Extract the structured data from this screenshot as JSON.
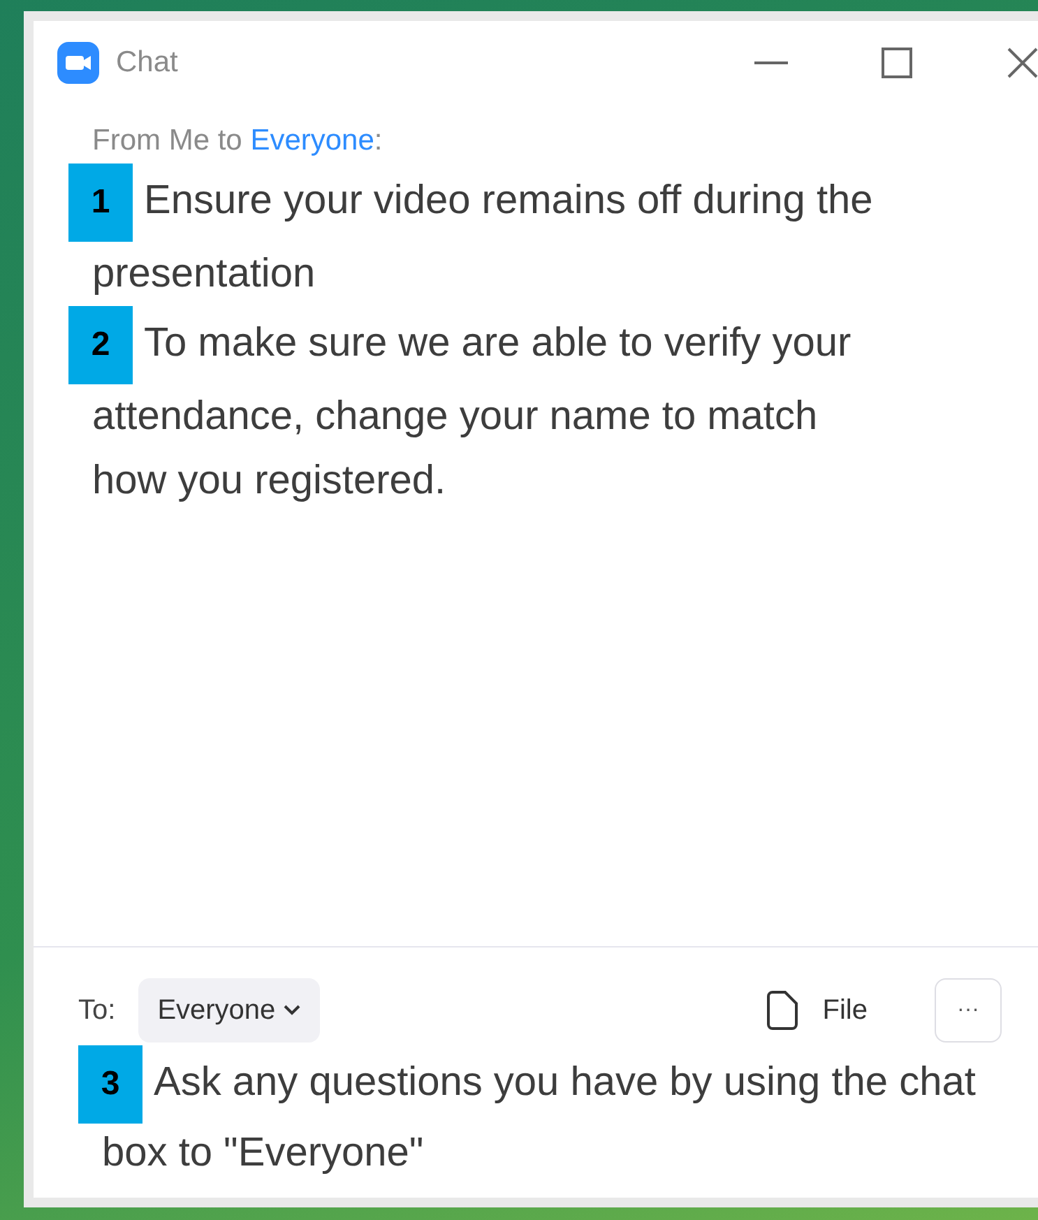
{
  "window": {
    "title": "Chat"
  },
  "chat_header": {
    "from": "From Me to",
    "recipient": "Everyone",
    "suffix": ":"
  },
  "messages": [
    {
      "badge": "1",
      "text": "Ensure your video remains off during the presentation"
    },
    {
      "badge": "2",
      "text": "To make sure we are able to verify your attendance, change your name to match how you registered."
    }
  ],
  "composer": {
    "to_label": "To:",
    "recipient": "Everyone",
    "file_label": "File",
    "more": "···",
    "badge": "3",
    "value": "Ask any questions you have by using the chat box to \"Everyone\""
  }
}
